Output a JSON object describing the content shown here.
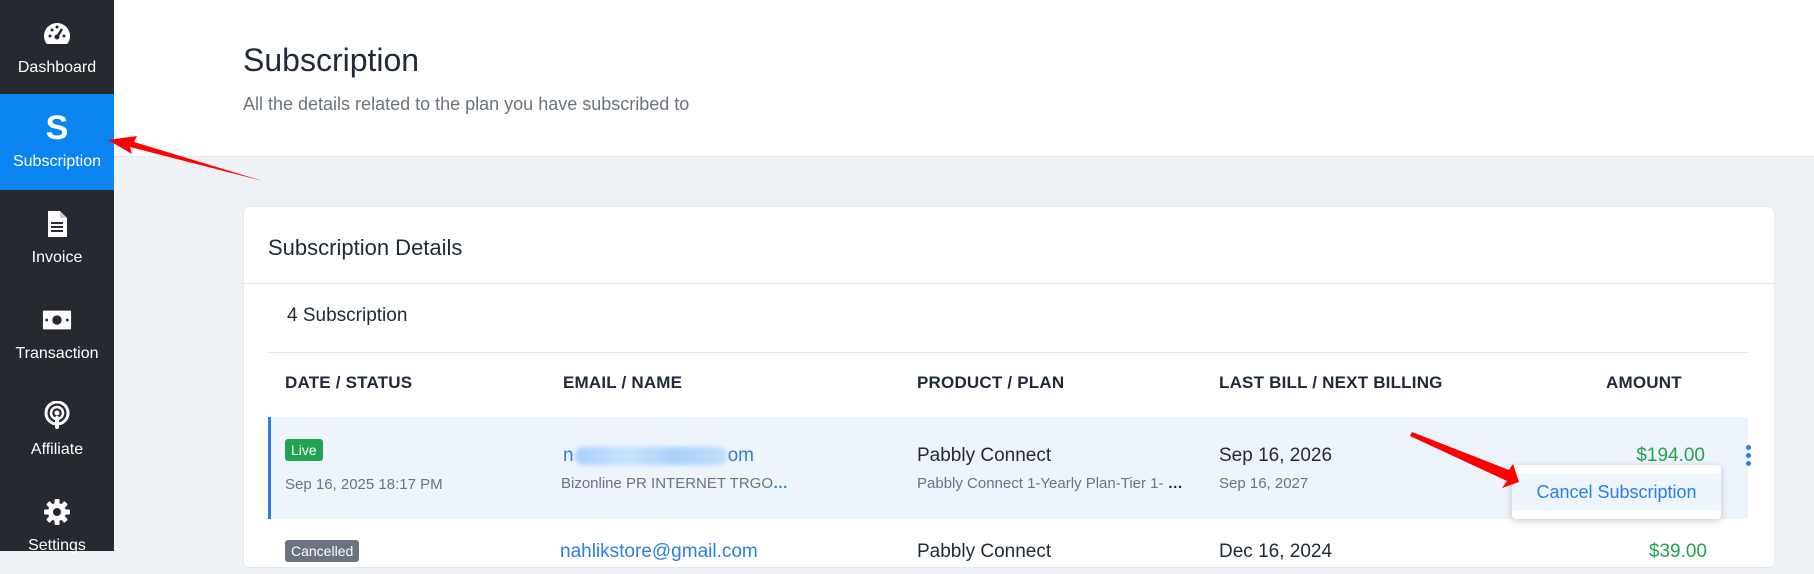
{
  "sidebar": {
    "items": [
      {
        "label": "Dashboard",
        "icon": "dashboard-gauge-icon"
      },
      {
        "label": "Subscription",
        "icon": "subscription-s-icon",
        "glyph": "S",
        "active": true
      },
      {
        "label": "Invoice",
        "icon": "invoice-document-icon"
      },
      {
        "label": "Transaction",
        "icon": "transaction-cash-icon"
      },
      {
        "label": "Affiliate",
        "icon": "affiliate-podcast-icon"
      },
      {
        "label": "Settings",
        "icon": "settings-gear-icon"
      }
    ]
  },
  "header": {
    "title": "Subscription",
    "subtitle": "All the details related to the plan you have subscribed to"
  },
  "card": {
    "title": "Subscription Details",
    "count": "4 Subscription",
    "columns": [
      "DATE / STATUS",
      "EMAIL / NAME",
      "PRODUCT / PLAN",
      "LAST BILL / NEXT BILLING",
      "AMOUNT"
    ],
    "rows": [
      {
        "status": "Live",
        "date": "Sep 16, 2025 18:17 PM",
        "email_start": "n",
        "email_end": "om",
        "name": "Bizonline PR INTERNET TRGO",
        "name_more": "…",
        "product": "Pabbly Connect",
        "plan": "Pabbly Connect 1-Yearly Plan-Tier 1-",
        "plan_more": "…",
        "last_bill": "Sep 16, 2026",
        "next_billing": "Sep 16, 2027",
        "amount": "$194.00"
      },
      {
        "status": "Cancelled",
        "email": "nahlikstore@gmail.com",
        "product": "Pabbly Connect",
        "last_bill": "Dec 16, 2024",
        "amount": "$39.00"
      }
    ]
  },
  "dropdown": {
    "cancel_label": "Cancel Subscription"
  },
  "colors": {
    "sidebar_bg": "#262a30",
    "active_bg": "#0a84f0",
    "accent_blue": "#2b7de9",
    "success_green": "#22a352",
    "annotation_red": "#ff0000"
  }
}
